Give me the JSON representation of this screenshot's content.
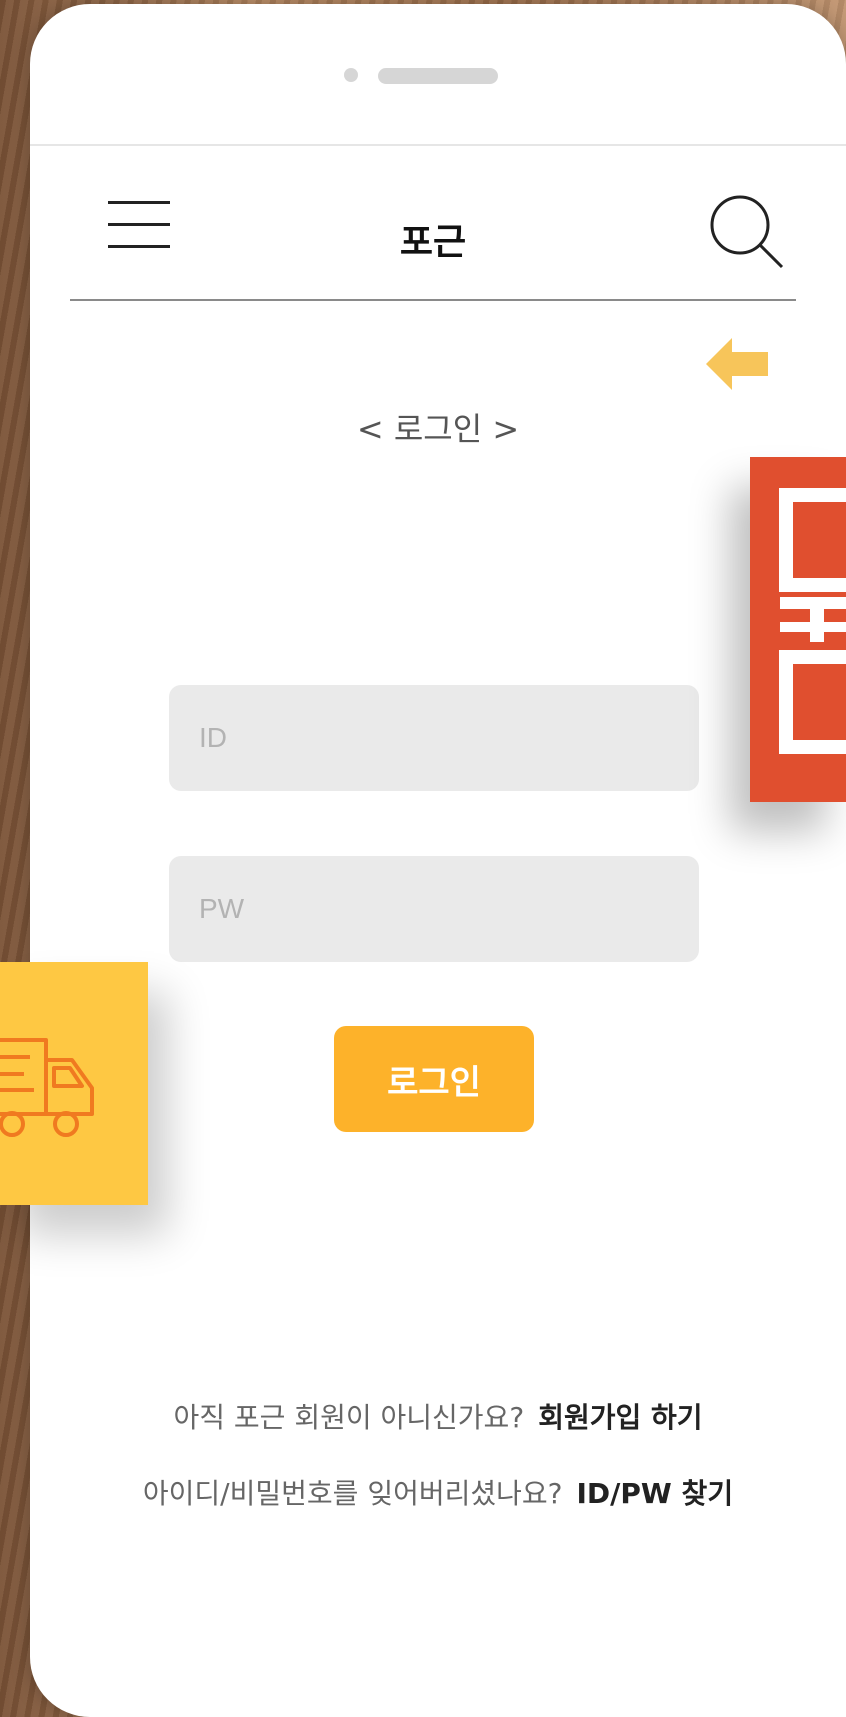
{
  "header": {
    "title": "포근",
    "menu_icon": "hamburger-menu-icon",
    "search_icon": "search-icon"
  },
  "back_icon": "back-arrow-icon",
  "login": {
    "heading": "< 로그인 >",
    "id_placeholder": "ID",
    "pw_placeholder": "PW",
    "button_label": "로그인"
  },
  "footer": {
    "signup_prompt": "아직 포근 회원이 아니신가요?",
    "signup_link": "회원가입 하기",
    "find_prompt": "아이디/비밀번호를 잊어버리셨나요?",
    "find_link": "ID/PW 찾기"
  },
  "colors": {
    "accent": "#fdb22a",
    "back_arrow": "#f7c55a",
    "red_card": "#e04f2f",
    "yellow_card": "#fec843",
    "truck_line": "#f07a20"
  },
  "decor": {
    "truck_icon": "delivery-truck-icon",
    "logo": "logo-mark"
  }
}
